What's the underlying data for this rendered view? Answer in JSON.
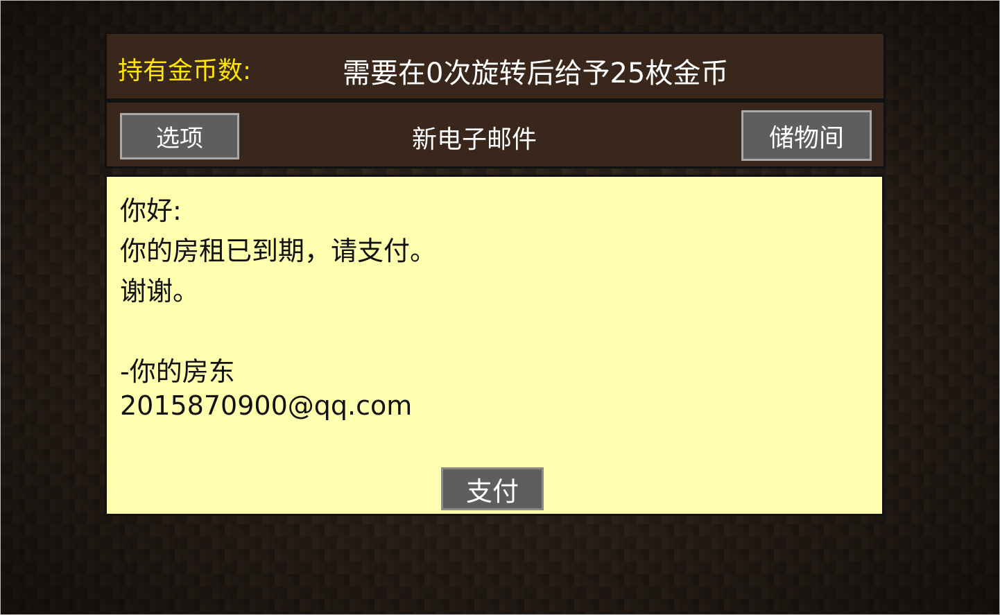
{
  "header": {
    "coins_label": "持有金币数:",
    "requirement": "需要在0次旋转后给予25枚金币"
  },
  "toolbar": {
    "options_label": "选项",
    "title": "新电子邮件",
    "storage_label": "储物间"
  },
  "email": {
    "greeting": "你好:",
    "body": "你的房租已到期，请支付。",
    "thanks": "谢谢。",
    "signature": "-你的房东",
    "address": "2015870900@qq.com",
    "pay_label": "支付"
  },
  "colors": {
    "coins_label": "#ffe600",
    "panel_dark": "#3a271b",
    "email_background": "#fffeae",
    "button_fill": "#5e5e5e"
  }
}
